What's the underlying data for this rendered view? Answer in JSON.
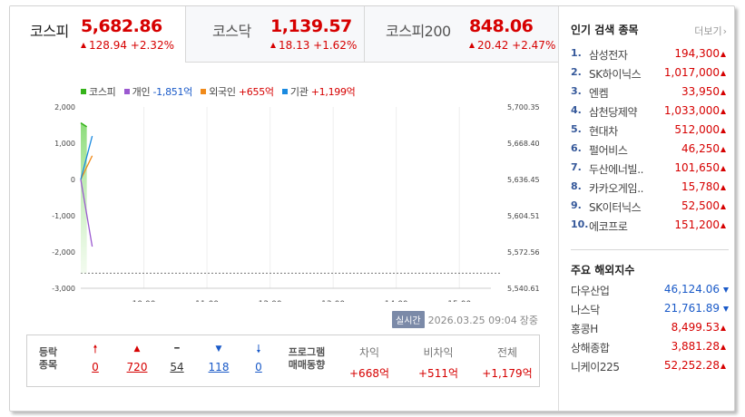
{
  "tabs": [
    {
      "name": "코스피",
      "value": "5,682.86",
      "change": "128.94 +2.32%"
    },
    {
      "name": "코스닥",
      "value": "1,139.57",
      "change": "18.13 +1.62%"
    },
    {
      "name": "코스피200",
      "value": "848.06",
      "change": "20.42 +2.47%"
    }
  ],
  "legend": [
    {
      "name": "코스피",
      "value": "",
      "color": "#35b31a"
    },
    {
      "name": "개인",
      "value": "-1,851억",
      "color": "#9b59d0"
    },
    {
      "name": "외국인",
      "value": "+655억",
      "color": "#f08a1a"
    },
    {
      "name": "기관",
      "value": "+1,199억",
      "color": "#1a8ae0"
    }
  ],
  "chart_data": {
    "type": "line",
    "x_ticks": [
      "10:00",
      "11:00",
      "12:00",
      "13:00",
      "14:00",
      "15:00"
    ],
    "y_left_ticks": [
      "2,000",
      "1,000",
      "0",
      "-1,000",
      "-2,000",
      "-3,000"
    ],
    "y_left_range": [
      -3000,
      2000
    ],
    "y_right_ticks": [
      "5,700.35",
      "5,668.40",
      "5,636.45",
      "5,604.51",
      "5,572.56",
      "5,540.61"
    ],
    "y_right_range": [
      5540.61,
      5700.35
    ],
    "x_range": [
      "09:00",
      "15:30"
    ],
    "kospi_baseline": 5553.92,
    "series": [
      {
        "name": "코스피",
        "axis": "right",
        "x": [
          "09:00",
          "09:04"
        ],
        "values": [
          5640.0,
          5682.86
        ]
      },
      {
        "name": "개인",
        "axis": "left",
        "x": [
          "09:00",
          "09:04"
        ],
        "values": [
          0,
          -1851
        ]
      },
      {
        "name": "외국인",
        "axis": "left",
        "x": [
          "09:00",
          "09:04"
        ],
        "values": [
          0,
          655
        ]
      },
      {
        "name": "기관",
        "axis": "left",
        "x": [
          "09:00",
          "09:04"
        ],
        "values": [
          0,
          1199
        ]
      }
    ]
  },
  "timebar": {
    "live": "실시간",
    "timestamp": "2026.03.25 09:04",
    "status": "장중"
  },
  "stats": {
    "title_line1": "등락",
    "title_line2": "종목",
    "items": [
      {
        "icon": "🠕",
        "value": "0",
        "kind": "up-limit"
      },
      {
        "icon": "▲",
        "value": "720",
        "kind": "up"
      },
      {
        "icon": "━",
        "value": "54",
        "kind": "flat"
      },
      {
        "icon": "▼",
        "value": "118",
        "kind": "down"
      },
      {
        "icon": "🠗",
        "value": "0",
        "kind": "down-limit"
      }
    ],
    "program_title_line1": "프로그램",
    "program_title_line2": "매매동향",
    "program": [
      {
        "head": "차익",
        "value": "+668억"
      },
      {
        "head": "비차익",
        "value": "+511억"
      },
      {
        "head": "전체",
        "value": "+1,179억"
      }
    ]
  },
  "popular": {
    "title": "인기 검색 종목",
    "more": "더보기",
    "items": [
      {
        "rank": "1.",
        "name": "삼성전자",
        "price": "194,300"
      },
      {
        "rank": "2.",
        "name": "SK하이닉스",
        "price": "1,017,000"
      },
      {
        "rank": "3.",
        "name": "엔켐",
        "price": "33,950"
      },
      {
        "rank": "4.",
        "name": "삼천당제약",
        "price": "1,033,000"
      },
      {
        "rank": "5.",
        "name": "현대차",
        "price": "512,000"
      },
      {
        "rank": "6.",
        "name": "펄어비스",
        "price": "46,250"
      },
      {
        "rank": "7.",
        "name": "두산에너빌..",
        "price": "101,650"
      },
      {
        "rank": "8.",
        "name": "카카오게임..",
        "price": "15,780"
      },
      {
        "rank": "9.",
        "name": "SK이터닉스",
        "price": "52,500"
      },
      {
        "rank": "10.",
        "name": "에코프로",
        "price": "151,200"
      }
    ]
  },
  "world": {
    "title": "주요 해외지수",
    "items": [
      {
        "name": "다우산업",
        "value": "46,124.06",
        "dir": "down"
      },
      {
        "name": "나스닥",
        "value": "21,761.89",
        "dir": "down"
      },
      {
        "name": "홍콩H",
        "value": "8,499.53",
        "dir": "up"
      },
      {
        "name": "상해종합",
        "value": "3,881.28",
        "dir": "up"
      },
      {
        "name": "니케이225",
        "value": "52,252.28",
        "dir": "up"
      }
    ]
  },
  "colors": {
    "up": "#d60000",
    "down": "#1a5ac8"
  }
}
